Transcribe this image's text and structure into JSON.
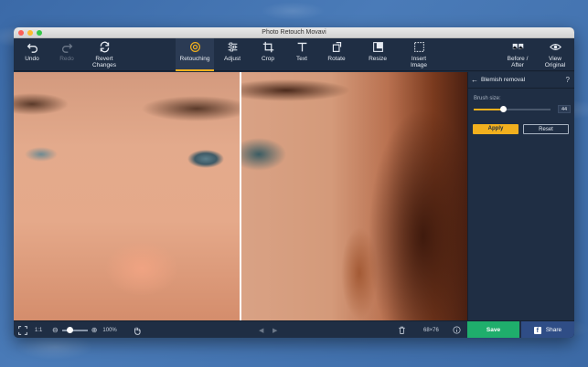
{
  "window": {
    "title": "Photo Retouch Movavi"
  },
  "toolbar": {
    "undo": "Undo",
    "redo": "Redo",
    "revert": "Revert\nChanges",
    "retouching": "Retouching",
    "adjust": "Adjust",
    "crop": "Crop",
    "text": "Text",
    "rotate": "Rotate",
    "resize": "Resize",
    "insert": "Insert\nImage",
    "before_after": "Before /\nAfter",
    "view_original": "View\nOriginal"
  },
  "panel": {
    "title": "Blemish removal",
    "help": "?",
    "brush_label": "Brush size:",
    "brush_value": "44",
    "brush_fraction": 0.38,
    "apply": "Apply",
    "reset": "Reset"
  },
  "statusbar": {
    "fit_label": "1:1",
    "zoom": "100%",
    "zoom_fraction": 0.3,
    "dimensions": "68×76",
    "save": "Save",
    "share": "Share"
  },
  "colors": {
    "accent": "#f2b01e",
    "save": "#1fae6c",
    "share": "#2f4d86"
  }
}
